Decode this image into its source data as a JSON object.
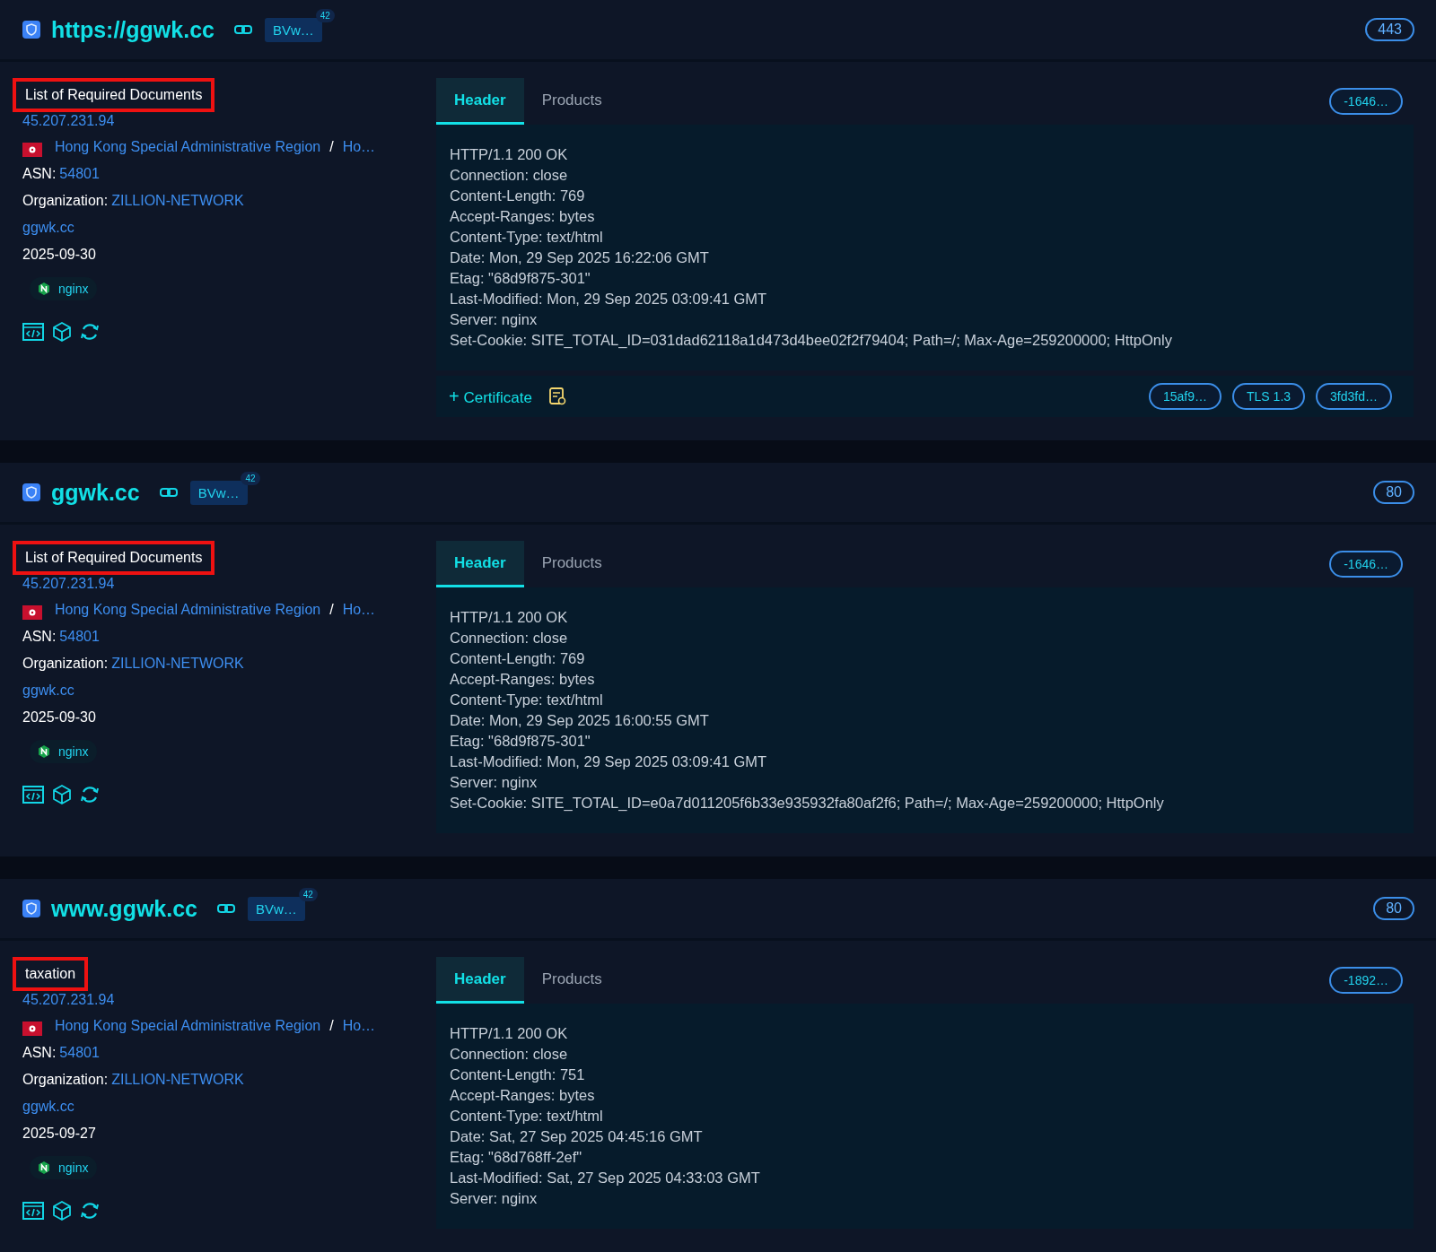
{
  "cards": [
    {
      "title": "https://ggwk.cc",
      "tag": "BVw…",
      "tag_count": "42",
      "port": "443",
      "page_title": "List of Required Documents",
      "highlighted": true,
      "ip": "45.207.231.94",
      "region": "Hong Kong Special Administrative Region",
      "separator": "/",
      "city": "Ho…",
      "asn_label": "ASN:",
      "asn": "54801",
      "org_label": "Organization:",
      "org": "ZILLION-NETWORK",
      "domain": "ggwk.cc",
      "date": "2025-09-30",
      "products": [
        "nginx"
      ],
      "tabs": [
        {
          "label": "Header",
          "selected": true
        },
        {
          "label": "Products",
          "selected": false
        }
      ],
      "hash": "-1646…",
      "header_lines": [
        "HTTP/1.1 200 OK",
        "Connection: close",
        "Content-Length: 769",
        "Accept-Ranges: bytes",
        "Content-Type: text/html",
        "Date: Mon, 29 Sep 2025 16:22:06 GMT",
        "Etag: \"68d9f875-301\"",
        "Last-Modified: Mon, 29 Sep 2025 03:09:41 GMT",
        "Server: nginx",
        "Set-Cookie: SITE_TOTAL_ID=031dad62118a1d473d4bee02f2f79404; Path=/; Max-Age=259200000; HttpOnly"
      ],
      "certificate": {
        "toggle": "+",
        "label": "Certificate",
        "chips": [
          "15af9…",
          "TLS 1.3",
          "3fd3fd…"
        ]
      }
    },
    {
      "title": "ggwk.cc",
      "tag": "BVw…",
      "tag_count": "42",
      "port": "80",
      "page_title": "List of Required Documents",
      "highlighted": true,
      "ip": "45.207.231.94",
      "region": "Hong Kong Special Administrative Region",
      "separator": "/",
      "city": "Ho…",
      "asn_label": "ASN:",
      "asn": "54801",
      "org_label": "Organization:",
      "org": "ZILLION-NETWORK",
      "domain": "ggwk.cc",
      "date": "2025-09-30",
      "products": [
        "nginx"
      ],
      "tabs": [
        {
          "label": "Header",
          "selected": true
        },
        {
          "label": "Products",
          "selected": false
        }
      ],
      "hash": "-1646…",
      "header_lines": [
        "HTTP/1.1 200 OK",
        "Connection: close",
        "Content-Length: 769",
        "Accept-Ranges: bytes",
        "Content-Type: text/html",
        "Date: Mon, 29 Sep 2025 16:00:55 GMT",
        "Etag: \"68d9f875-301\"",
        "Last-Modified: Mon, 29 Sep 2025 03:09:41 GMT",
        "Server: nginx",
        "Set-Cookie: SITE_TOTAL_ID=e0a7d011205f6b33e935932fa80af2f6; Path=/; Max-Age=259200000; HttpOnly"
      ]
    },
    {
      "title": "www.ggwk.cc",
      "tag": "BVw…",
      "tag_count": "42",
      "port": "80",
      "page_title": "taxation",
      "highlighted": true,
      "ip": "45.207.231.94",
      "region": "Hong Kong Special Administrative Region",
      "separator": "/",
      "city": "Ho…",
      "asn_label": "ASN:",
      "asn": "54801",
      "org_label": "Organization:",
      "org": "ZILLION-NETWORK",
      "domain": "ggwk.cc",
      "date": "2025-09-27",
      "products": [
        "nginx"
      ],
      "tabs": [
        {
          "label": "Header",
          "selected": true
        },
        {
          "label": "Products",
          "selected": false
        }
      ],
      "hash": "-1892…",
      "header_lines": [
        "HTTP/1.1 200 OK",
        "Connection: close",
        "Content-Length: 751",
        "Accept-Ranges: bytes",
        "Content-Type: text/html",
        "Date: Sat, 27 Sep 2025 04:45:16 GMT",
        "Etag: \"68d768ff-2ef\"",
        "Last-Modified: Sat, 27 Sep 2025 04:33:03 GMT",
        "Server: nginx"
      ]
    }
  ]
}
